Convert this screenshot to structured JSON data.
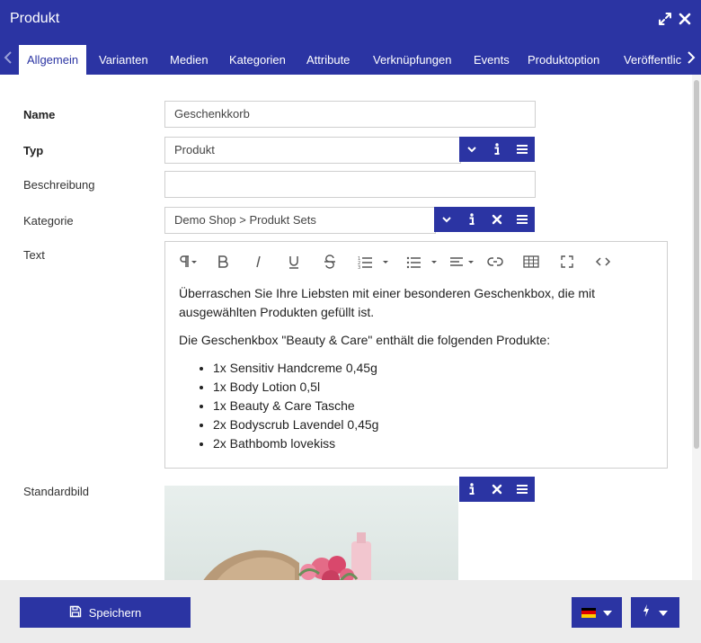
{
  "window": {
    "title": "Produkt"
  },
  "tabs": [
    {
      "label": "Allgemein",
      "active": true
    },
    {
      "label": "Varianten"
    },
    {
      "label": "Medien"
    },
    {
      "label": "Kategorien"
    },
    {
      "label": "Attribute"
    },
    {
      "label": "Verknüpfungen"
    },
    {
      "label": "Events"
    },
    {
      "label": "Produktoption"
    },
    {
      "label": "Veröffentlic"
    }
  ],
  "form": {
    "name": {
      "label": "Name",
      "value": "Geschenkkorb"
    },
    "type": {
      "label": "Typ",
      "value": "Produkt"
    },
    "description": {
      "label": "Beschreibung",
      "value": ""
    },
    "category": {
      "label": "Kategorie",
      "value": "Demo Shop > Produkt Sets"
    },
    "text": {
      "label": "Text",
      "paragraphs": [
        "Überraschen Sie Ihre Liebsten mit einer besonderen Geschenkbox, die mit ausgewählten Produkten gefüllt ist.",
        "Die Geschenkbox \"Beauty & Care\" enthält die folgenden Produkte:"
      ],
      "items": [
        "1x Sensitiv Handcreme 0,45g",
        "1x Body Lotion 0,5l",
        "1x Beauty & Care Tasche",
        "2x Bodyscrub Lavendel 0,45g",
        "2x Bathbomb lovekiss"
      ]
    },
    "image": {
      "label": "Standardbild"
    }
  },
  "footer": {
    "save_label": "Speichern",
    "language": "de"
  },
  "colors": {
    "primary": "#2b34a3",
    "footer_bg": "#ececec"
  },
  "icons": [
    "expand-icon",
    "close-icon",
    "chevron-left-icon",
    "chevron-right-icon",
    "chevron-down-icon",
    "info-icon",
    "x-icon",
    "menu-icon",
    "save-icon",
    "flag-de-icon",
    "bolt-icon"
  ]
}
